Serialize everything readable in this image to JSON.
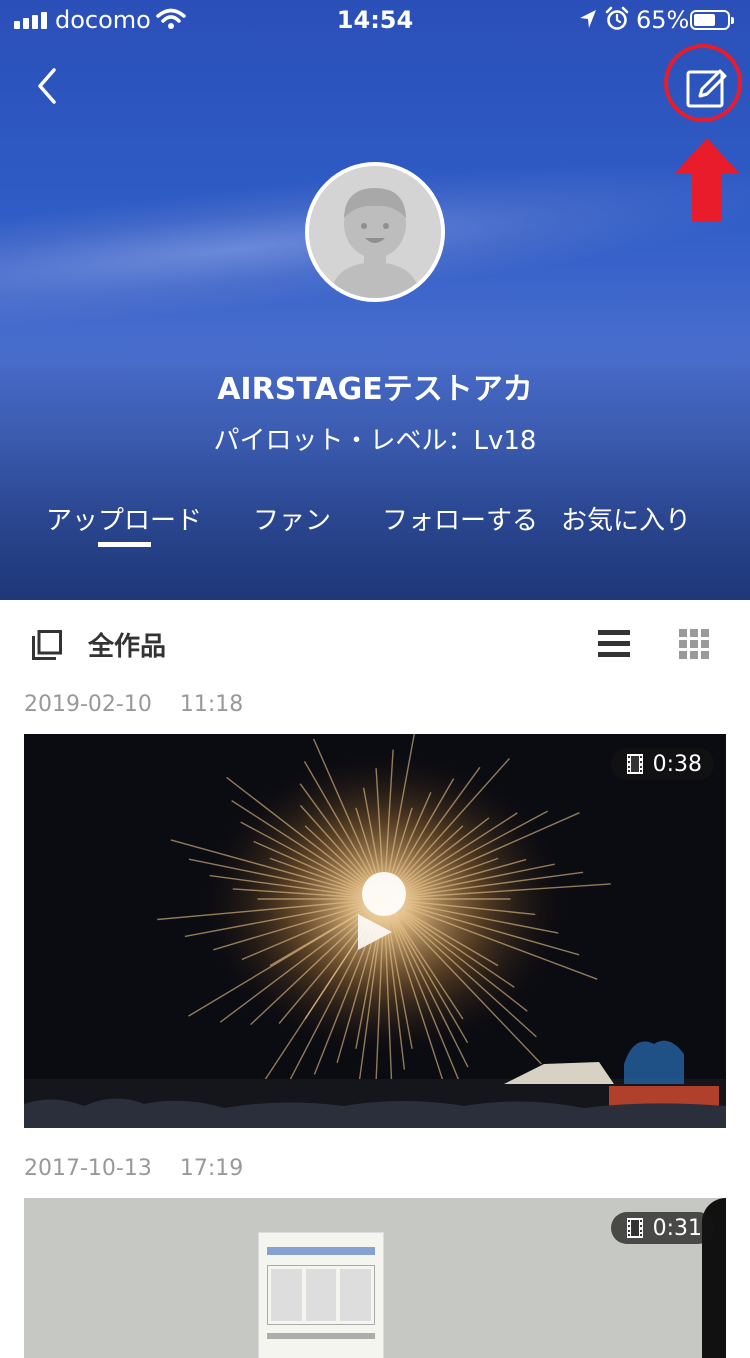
{
  "status_bar": {
    "carrier": "docomo",
    "time": "14:54",
    "battery_percent_text": "65%",
    "battery_level": 0.65
  },
  "profile": {
    "username": "AIRSTAGEテストアカ",
    "level_text": "パイロット・レベル：Lv18"
  },
  "tabs": [
    {
      "label": "アップロード",
      "active": true
    },
    {
      "label": "ファン",
      "active": false
    },
    {
      "label": "フォローする",
      "active": false
    },
    {
      "label": "お気に入り",
      "active": false
    }
  ],
  "works": {
    "title": "全作品"
  },
  "posts": [
    {
      "date": "2019-02-10",
      "time": "11:18",
      "duration": "0:38"
    },
    {
      "date": "2017-10-13",
      "time": "17:19",
      "duration": "0:31"
    }
  ],
  "colors": {
    "highlight_ring": "#e81c2a",
    "accent_white": "#ffffff"
  },
  "icons": [
    "back-chevron-icon",
    "edit-icon",
    "works-stack-icon",
    "list-view-icon",
    "grid-view-icon",
    "film-icon",
    "play-icon"
  ]
}
